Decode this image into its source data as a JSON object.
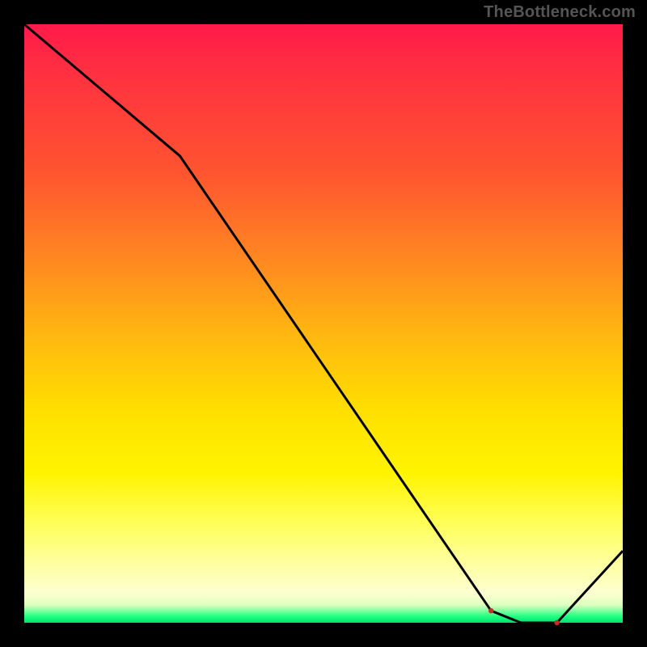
{
  "watermark": "TheBottleneck.com",
  "chart_data": {
    "type": "line",
    "title": "",
    "xlabel": "",
    "ylabel": "",
    "xlim": [
      0,
      100
    ],
    "ylim": [
      0,
      100
    ],
    "grid": false,
    "legend": false,
    "series": [
      {
        "name": "bottleneck-curve",
        "x": [
          0,
          26,
          78,
          83,
          89,
          100
        ],
        "values": [
          100,
          78,
          2,
          0,
          0,
          12
        ]
      }
    ],
    "annotations": [
      {
        "x": 78,
        "y": 2,
        "kind": "marker",
        "name": "min-marker-1"
      },
      {
        "x": 89,
        "y": 0,
        "kind": "marker",
        "name": "min-marker-2"
      },
      {
        "x": 83,
        "y": 1.5,
        "kind": "label",
        "text": ""
      }
    ]
  },
  "colors": {
    "line": "#000000",
    "accent": "#c03020",
    "bg_top": "#ff1a4a",
    "bg_bottom": "#00e070"
  }
}
